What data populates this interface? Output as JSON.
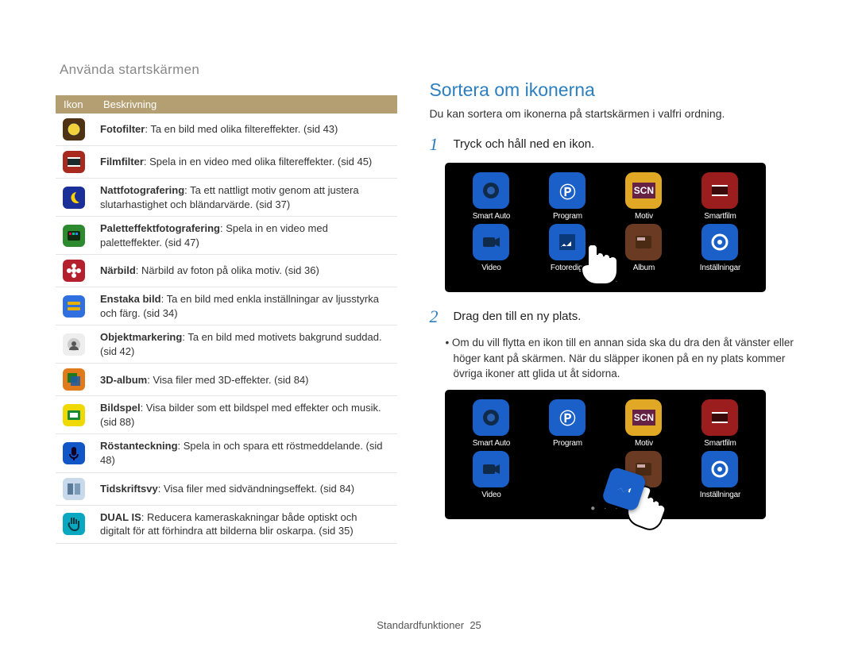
{
  "breadcrumb": "Använda startskärmen",
  "table": {
    "headers": [
      "Ikon",
      "Beskrivning"
    ],
    "rows": [
      {
        "icon": {
          "bg": "#4f3113",
          "type": "circle-yellow"
        },
        "title": "Fotofilter",
        "text_after": ": Ta en bild med olika filtereffekter. (sid 43)"
      },
      {
        "icon": {
          "bg": "#a82a1f",
          "type": "film"
        },
        "title": "Filmfilter",
        "text_after": ": Spela in en video med olika filtereffekter. (sid 45)"
      },
      {
        "icon": {
          "bg": "#1a2f97",
          "type": "moon"
        },
        "title": "Nattfotografering",
        "text_after": ": Ta ett nattligt motiv genom att justera slutarhastighet och bländarvärde. (sid 37)"
      },
      {
        "icon": {
          "bg": "#2e8a2e",
          "type": "palette"
        },
        "title": "Paletteffektfotografering",
        "text_after": ": Spela in en video med paletteffekter. (sid 47)"
      },
      {
        "icon": {
          "bg": "#b5202f",
          "type": "flower"
        },
        "title": "Närbild",
        "text_after": ": Närbild av foton på olika motiv. (sid 36)"
      },
      {
        "icon": {
          "bg": "#2f6fe0",
          "type": "single"
        },
        "title": "Enstaka bild",
        "text_after": ": Ta en bild med enkla inställningar av ljusstyrka och färg. (sid 34)"
      },
      {
        "icon": {
          "bg": "#eee",
          "type": "obj"
        },
        "title": "Objektmarkering",
        "text_after": ": Ta en bild med motivets bakgrund suddad. (sid 42)"
      },
      {
        "icon": {
          "bg": "#e07a1a",
          "type": "3d"
        },
        "title": "3D-album",
        "text_after": ": Visa filer med 3D-effekter. (sid 84)"
      },
      {
        "icon": {
          "bg": "#efd900",
          "type": "slides"
        },
        "title": "Bildspel",
        "text_after": ": Visa bilder som ett bildspel med effekter och musik. (sid 88)"
      },
      {
        "icon": {
          "bg": "#1056c6",
          "type": "mic"
        },
        "title": "Röstanteckning",
        "text_after": ": Spela in och spara ett röstmeddelande. (sid 48)"
      },
      {
        "icon": {
          "bg": "#c7d9ea",
          "type": "mag"
        },
        "title": "Tidskriftsvy",
        "text_after": ": Visa filer med sidvändningseffekt. (sid 84)"
      },
      {
        "icon": {
          "bg": "#0aa8c0",
          "type": "hand"
        },
        "title": "DUAL IS",
        "text_after": ": Reducera kameraskakningar både optiskt och digitalt för att förhindra att bilderna blir oskarpa. (sid 35)"
      }
    ]
  },
  "section_title": "Sortera om ikonerna",
  "intro": "Du kan sortera om ikonerna på startskärmen i valfri ordning.",
  "steps": [
    {
      "num": "1",
      "text": "Tryck och håll ned en ikon."
    },
    {
      "num": "2",
      "text": "Drag den till en ny plats."
    }
  ],
  "bullet": "Om du vill flytta en ikon till en annan sida ska du dra den åt vänster eller höger kant på skärmen. När du släpper ikonen på en ny plats kommer övriga ikoner att glida ut åt sidorna.",
  "grid": {
    "rows": [
      [
        {
          "label": "Smart Auto",
          "bg": "#1a60c8",
          "tag": "lens"
        },
        {
          "label": "Program",
          "bg": "#1a60c8",
          "tag": "P"
        },
        {
          "label": "Motiv",
          "bg": "#e0a824",
          "tag": "SCN"
        },
        {
          "label": "Smartfilm",
          "bg": "#9c1d1d",
          "tag": "film"
        }
      ],
      [
        {
          "label": "Video",
          "bg": "#1a60c8",
          "tag": "rec"
        },
        {
          "label": "Fotoredig.",
          "bg": "#1a60c8",
          "tag": "edit"
        },
        {
          "label": "Album",
          "bg": "#6a3b22",
          "tag": "album"
        },
        {
          "label": "Inställningar",
          "bg": "#1a60c8",
          "tag": "gear"
        }
      ]
    ]
  },
  "grid2": {
    "rows": [
      [
        {
          "label": "Smart Auto",
          "bg": "#1a60c8",
          "tag": "lens"
        },
        {
          "label": "Program",
          "bg": "#1a60c8",
          "tag": "P"
        },
        {
          "label": "Motiv",
          "bg": "#e0a824",
          "tag": "SCN"
        },
        {
          "label": "Smartfilm",
          "bg": "#9c1d1d",
          "tag": "film"
        }
      ],
      [
        {
          "label": "Video",
          "bg": "#1a60c8",
          "tag": "rec"
        },
        {
          "label": "",
          "bg": "",
          "tag": ""
        },
        {
          "label": "m",
          "bg": "#6a3b22",
          "tag": "album"
        },
        {
          "label": "Inställningar",
          "bg": "#1a60c8",
          "tag": "gear"
        }
      ]
    ],
    "dragging": {
      "bg": "#1a60c8",
      "tag": "edit",
      "label": ""
    }
  },
  "footer_prefix": "Standardfunktioner",
  "footer_page": "25"
}
